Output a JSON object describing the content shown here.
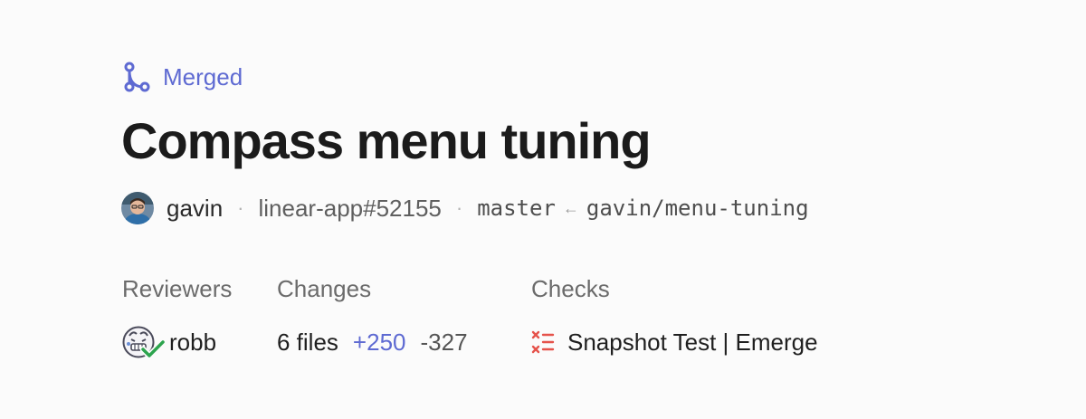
{
  "status": {
    "label": "Merged",
    "icon": "git-merge-icon",
    "color": "#5e6ad2"
  },
  "title": "Compass menu tuning",
  "meta": {
    "author": "gavin",
    "author_avatar": "user-avatar",
    "pr_ref": "linear-app#52155",
    "base_branch": "master",
    "arrow": "←",
    "head_branch": "gavin/menu-tuning",
    "separator": "·"
  },
  "reviewers": {
    "label": "Reviewers",
    "name": "robb",
    "avatar": "reviewer-avatar",
    "approval_icon": "check-icon",
    "approval_color": "#2da44e"
  },
  "changes": {
    "label": "Changes",
    "files": "6 files",
    "additions": "+250",
    "deletions": "-327"
  },
  "checks": {
    "label": "Checks",
    "name": "Snapshot Test | Emerge",
    "icon": "failed-checks-icon",
    "color": "#e5534b"
  }
}
